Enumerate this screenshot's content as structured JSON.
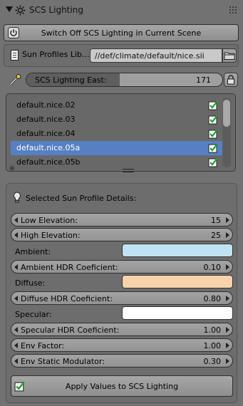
{
  "header": {
    "title": "SCS Lighting",
    "icon": "sun-gear-icon"
  },
  "power_button": {
    "label": "Switch Off SCS Lighting in Current Scene",
    "icon": "power-icon"
  },
  "sun_profiles": {
    "label": "Sun Profiles Lib...",
    "path": "//def/climate/default/nice.sii",
    "icon": "document-icon",
    "browse_icon": "folder-icon"
  },
  "east_slider": {
    "label": "SCS Lighting East:",
    "value": "171",
    "fraction": 0.475,
    "lock_icon": "padlock-icon"
  },
  "profiles_list": {
    "items": [
      {
        "label": "default.nice.02",
        "selected": false
      },
      {
        "label": "default.nice.03",
        "selected": false
      },
      {
        "label": "default.nice.04",
        "selected": false
      },
      {
        "label": "default.nice.05a",
        "selected": true
      },
      {
        "label": "default.nice.05b",
        "selected": false
      }
    ],
    "selection_color": "#5680c2"
  },
  "details": {
    "title": "Selected Sun Profile Details:",
    "low_elevation": {
      "label": "Low Elevation:",
      "value": "15"
    },
    "high_elevation": {
      "label": "High Elevation:",
      "value": "25"
    },
    "ambient": {
      "label": "Ambient:",
      "color": "#bfe3f2"
    },
    "ambient_hdr": {
      "label": "Ambient HDR Coeficient:",
      "value": "0.10"
    },
    "diffuse": {
      "label": "Diffuse:",
      "color": "#f6d3ab"
    },
    "diffuse_hdr": {
      "label": "Diffuse HDR Coeficient:",
      "value": "0.80"
    },
    "specular": {
      "label": "Specular:",
      "color": "#ffffff"
    },
    "specular_hdr": {
      "label": "Specular HDR Coeficient:",
      "value": "1.00"
    },
    "env_factor": {
      "label": "Env Factor:",
      "value": "1.00"
    },
    "env_static": {
      "label": "Env Static Modulator:",
      "value": "0.30"
    }
  },
  "apply_button": {
    "label": "Apply Values to SCS Lighting",
    "icon": "checkbox-checked-icon"
  }
}
